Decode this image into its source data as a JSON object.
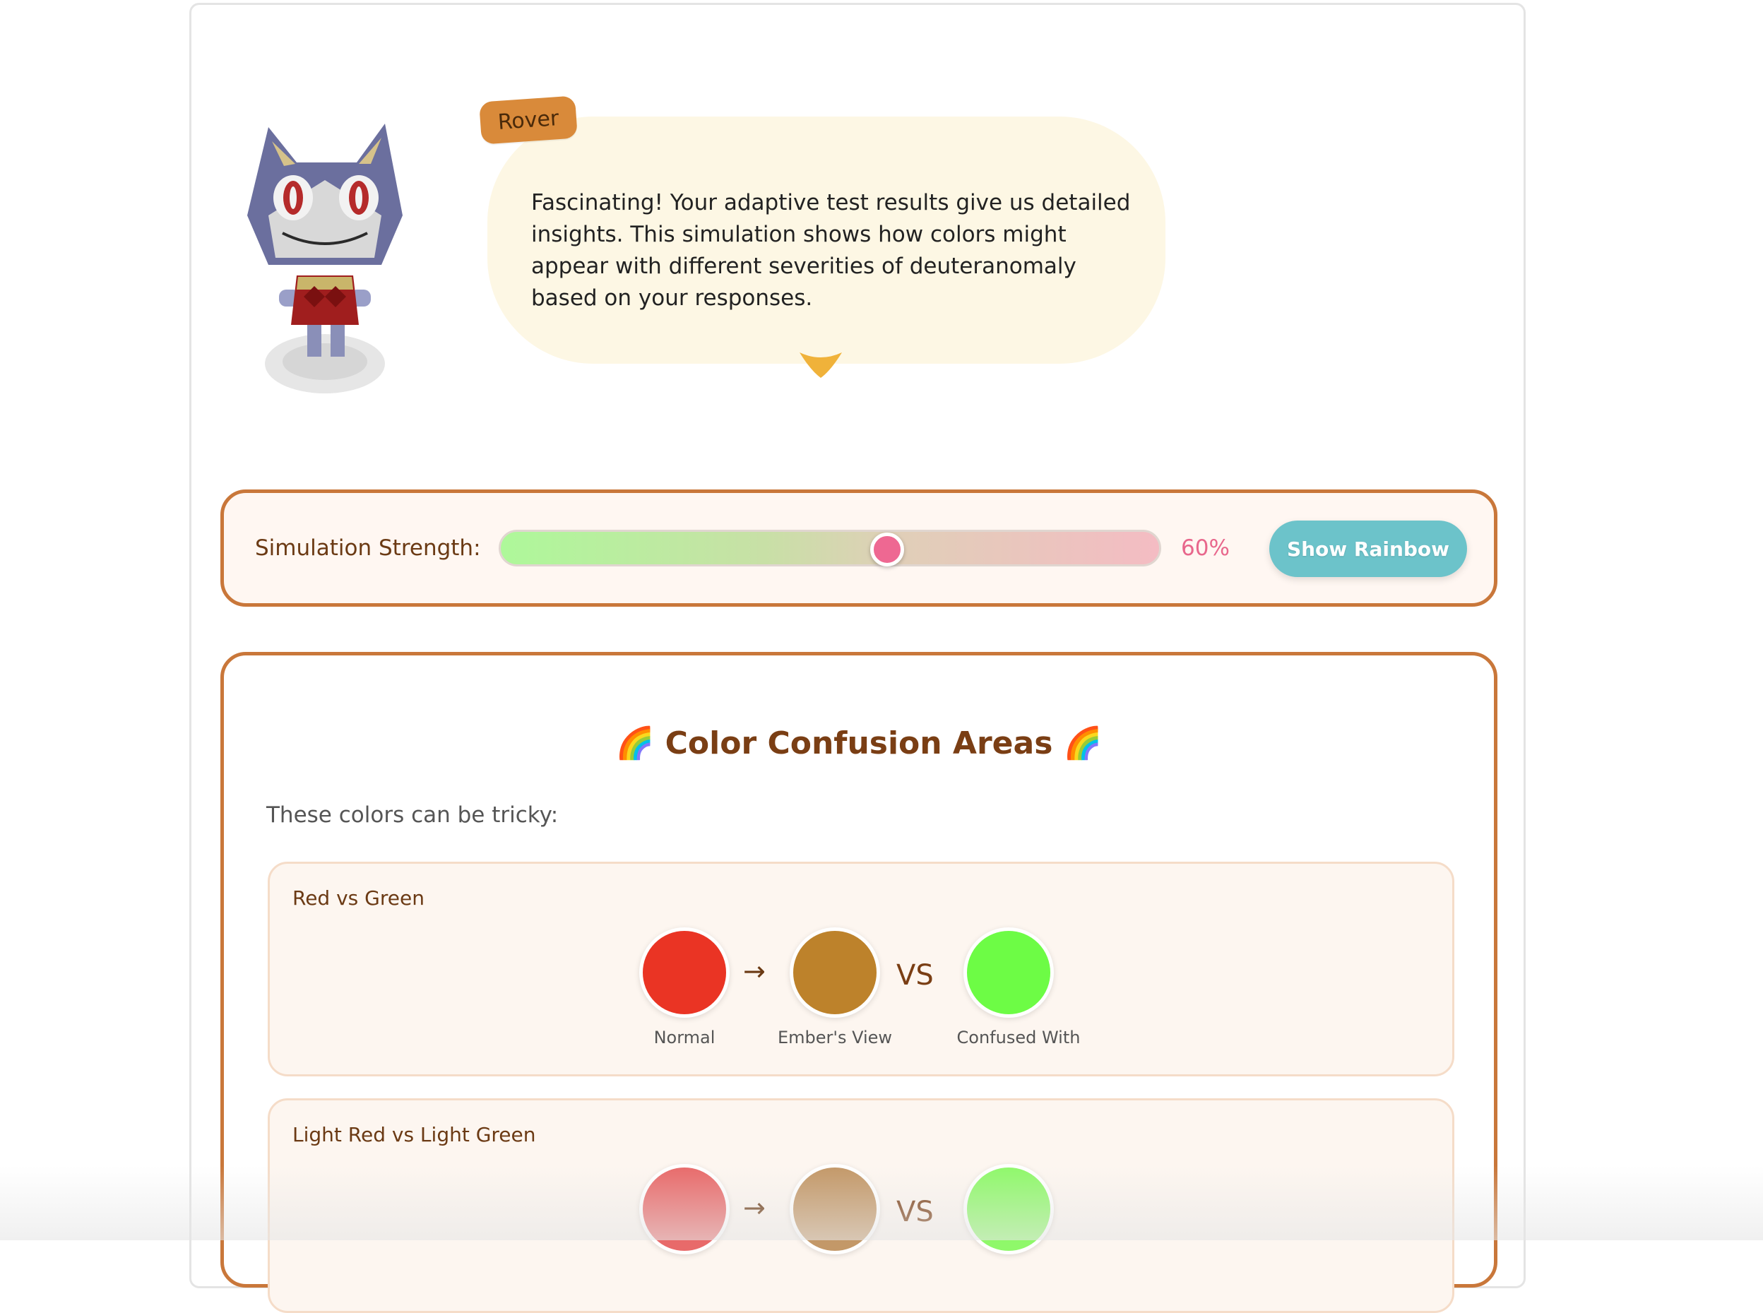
{
  "character": {
    "name": "Rover",
    "message": "Fascinating! Your adaptive test results give us detailed insights. This simulation shows how colors might appear with different severities of deuteranomaly based on your responses."
  },
  "controls": {
    "label": "Simulation Strength:",
    "value_percent": 60,
    "value_text": "60%",
    "button_label": "Show Rainbow"
  },
  "confusion": {
    "emoji": "🌈",
    "title": "Color Confusion Areas",
    "subtitle": "These colors can be tricky:",
    "captions": {
      "normal": "Normal",
      "simulated": "Ember's View",
      "confused": "Confused With"
    },
    "arrow": "→",
    "vs": "VS",
    "pairs": [
      {
        "title": "Red vs Green",
        "normal": "#ea3424",
        "simulated": "#bd822b",
        "confused": "#6dfc45"
      },
      {
        "title": "Light Red vs Light Green",
        "normal": "#e86a6a",
        "simulated": "#c39868",
        "confused": "#8ff86a"
      }
    ]
  },
  "colors": {
    "accent_border": "#c9773a",
    "button": "#6cc3ca",
    "slider_thumb": "#ee6892",
    "bubble_bg": "#fdf7e4",
    "name_tag": "#d98a3a"
  }
}
